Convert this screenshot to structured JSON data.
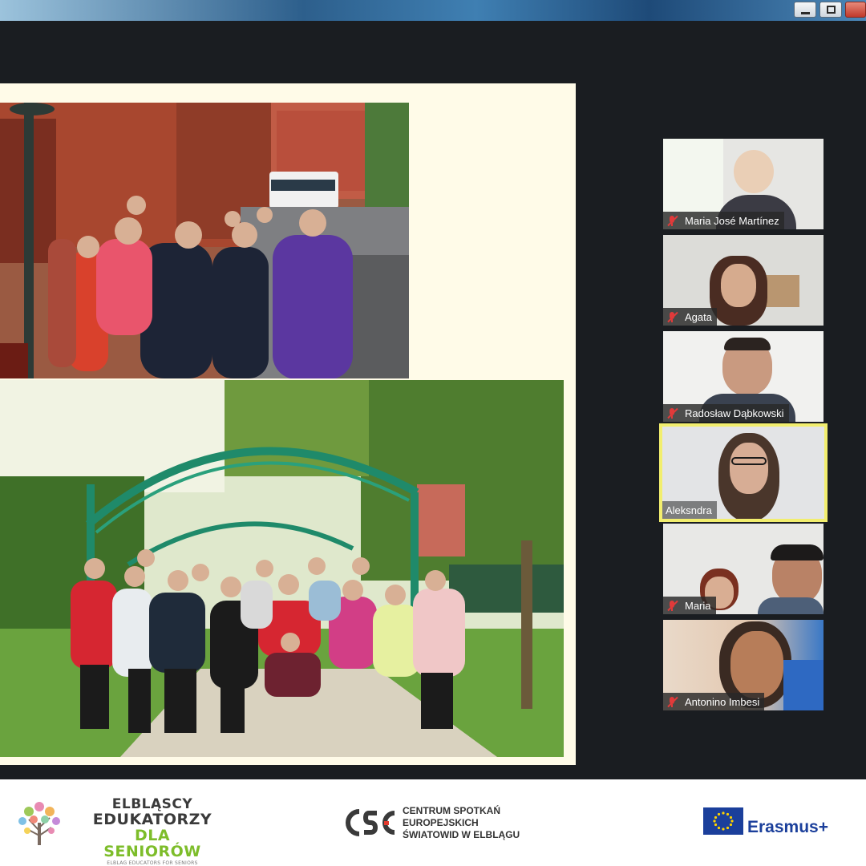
{
  "participants": [
    {
      "name": "Maria José Martínez",
      "muted": true
    },
    {
      "name": "Agata",
      "muted": true
    },
    {
      "name": "Radosław Dąbkowski",
      "muted": true
    },
    {
      "name": "Aleksndra",
      "muted": false,
      "active_speaker": true
    },
    {
      "name": "Maria",
      "muted": true
    },
    {
      "name": "Antonino Imbesi",
      "muted": true
    }
  ],
  "footer": {
    "elblag": {
      "line1": "ELBLĄSCY",
      "line2": "EDUKATORZY",
      "line3": "DLA SENIORÓW",
      "line4": "ELBLAG EDUCATORS FOR SENIORS"
    },
    "cse": {
      "line1": "CENTRUM SPOTKAŃ",
      "line2": "EUROPEJSKICH",
      "line3": "ŚWIATOWID W ELBLĄGU"
    },
    "erasmus": "Erasmus+"
  },
  "colors": {
    "meeting_bg": "#1a1d21",
    "slide_bg": "#fffbe8",
    "active_border": "#f2ee6e",
    "mute_red": "#e03a3a",
    "elblag_green": "#7dbd2a",
    "eu_blue": "#1b3f9b"
  }
}
